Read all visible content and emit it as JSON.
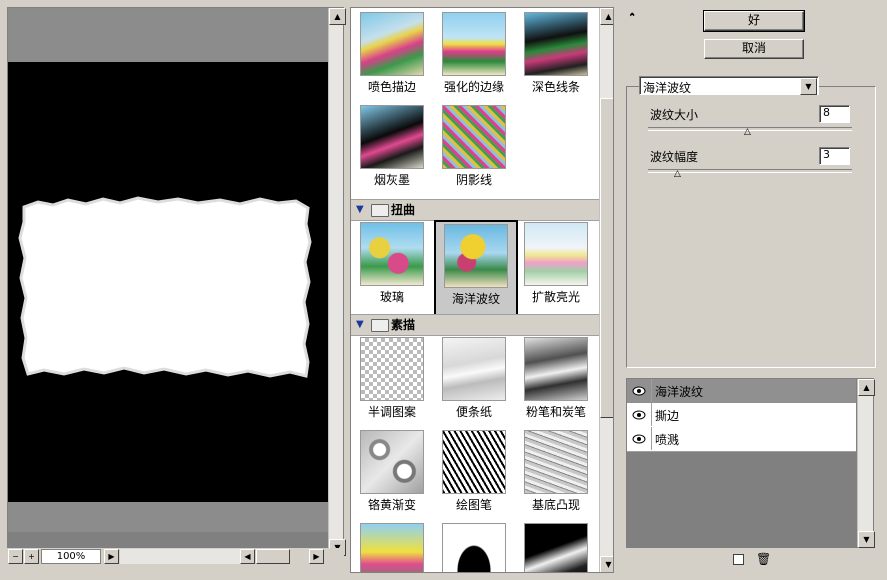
{
  "preview": {
    "title": "",
    "zoom": "100%"
  },
  "gallery": {
    "stylize_row1": [
      "喷色描边",
      "强化的边缘",
      "深色线条"
    ],
    "stylize_row2": [
      "烟灰墨",
      "阴影线"
    ],
    "distort": {
      "category": "扭曲",
      "items": [
        "玻璃",
        "海洋波纹",
        "扩散亮光"
      ],
      "selected": "海洋波纹"
    },
    "sketch": {
      "category": "素描",
      "items": [
        "半调图案",
        "便条纸",
        "粉笔和炭笔",
        "铬黄渐变",
        "绘图笔",
        "基底凸现"
      ]
    }
  },
  "controls": {
    "ok_label": "好",
    "cancel_label": "取消",
    "filter_select": "海洋波纹",
    "params": [
      {
        "label": "波纹大小",
        "value": "8",
        "level_fraction": 0.54
      },
      {
        "label": "波纹幅度",
        "value": "3",
        "level_fraction": 0.15
      }
    ]
  },
  "layers": {
    "items": [
      "海洋波纹",
      "撕边",
      "喷溅"
    ],
    "selected_index": 0
  },
  "colors": {
    "dialog_bg": "#d4d0c8",
    "selected_layer": "#909090"
  }
}
